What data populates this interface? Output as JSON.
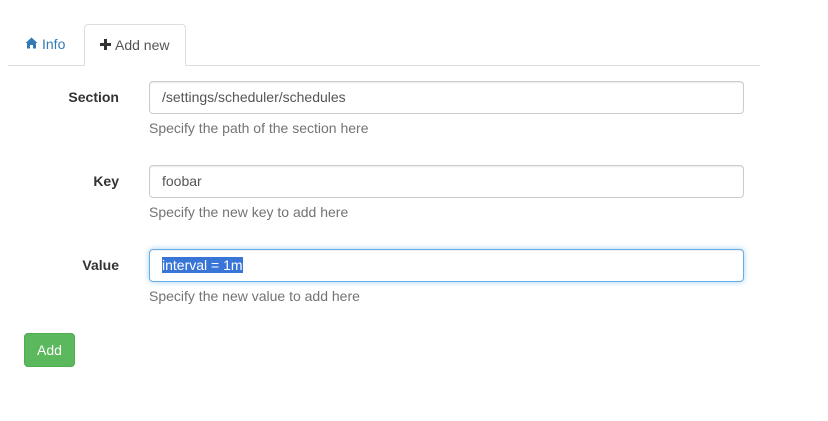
{
  "tabs": [
    {
      "label": "Info",
      "icon": "home-icon",
      "active": false
    },
    {
      "label": "Add new",
      "icon": "plus-icon",
      "active": true
    }
  ],
  "form": {
    "section": {
      "label": "Section",
      "value": "/settings/scheduler/schedules",
      "help": "Specify the path of the section here"
    },
    "key": {
      "label": "Key",
      "value": "foobar",
      "help": "Specify the new key to add here"
    },
    "value": {
      "label": "Value",
      "value": "interval = 1m",
      "help": "Specify the new value to add here",
      "focused": true,
      "text_selected": true
    },
    "submit_label": "Add"
  },
  "colors": {
    "link": "#337ab7",
    "button_bg": "#5cb85c",
    "focus_border": "#66afe9",
    "selection": "#3875d7"
  }
}
